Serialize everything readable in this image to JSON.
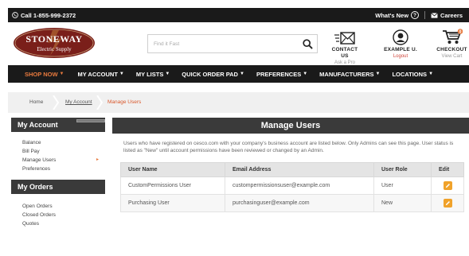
{
  "topbar": {
    "phone": "Call 1-855-999-2372",
    "whats_new": "What's New",
    "careers": "Careers"
  },
  "logo": {
    "line1": "STONEWAY",
    "line2": "Electric Supply"
  },
  "search": {
    "placeholder": "Find it Fast"
  },
  "header_items": {
    "contact": {
      "title": "CONTACT US",
      "sub": "Ask a Pro"
    },
    "user": {
      "title": "EXAMPLE U.",
      "sub": "Logout"
    },
    "checkout": {
      "title": "CHECKOUT",
      "sub": "View Cart",
      "badge": "0"
    }
  },
  "nav": {
    "shop_now": "SHOP NOW",
    "my_account": "MY ACCOUNT",
    "my_lists": "MY LISTS",
    "quick_order_pad": "QUICK ORDER PAD",
    "preferences": "PREFERENCES",
    "manufacturers": "MANUFACTURERS",
    "locations": "LOCATIONS"
  },
  "breadcrumb": {
    "home": "Home",
    "my_account": "My Account",
    "current": "Manage Users"
  },
  "sidebar": {
    "account_title": "My Account",
    "account_items": [
      "Balance",
      "Bill Pay",
      "Manage Users",
      "Preferences"
    ],
    "orders_title": "My Orders",
    "order_items": [
      "Open Orders",
      "Closed Orders",
      "Quotes"
    ]
  },
  "main": {
    "title": "Manage Users",
    "intro": "Users who have registered on cesco.com with your company's business account are listed below. Only Admins can see this page. User status is listed as \"New\" until account permissions have been reviewed or changed by an Admin.",
    "columns": [
      "User Name",
      "Email Address",
      "User Role",
      "Edit"
    ],
    "rows": [
      {
        "name": "CustomPermissions User",
        "email": "custompermissionsuser@example.com",
        "role": "User"
      },
      {
        "name": "Purchasing User",
        "email": "purchasinguser@example.com",
        "role": "New"
      }
    ]
  },
  "colors": {
    "accent": "#e87a3e",
    "dark": "#1a1a1a",
    "panel": "#3a3a3a",
    "edit": "#f0a22a"
  }
}
